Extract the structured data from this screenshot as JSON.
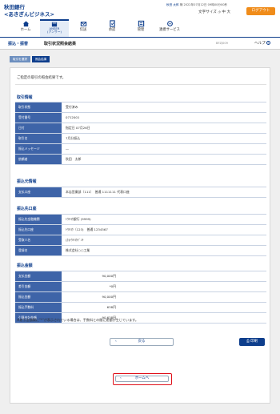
{
  "header": {
    "logo_line1": "秋田銀行",
    "logo_line2": "<あきぎんビジネス>",
    "user_name": "秋田 太郎",
    "user_suffix": "様",
    "last_login": "2022年07月12日 09時00分00秒",
    "font_size_label": "文字サイズ",
    "font_small": "小",
    "font_medium": "中",
    "font_large": "大",
    "logout_label": "ログアウト"
  },
  "nav": {
    "items": [
      {
        "label": "ホーム",
        "icon": "home-icon"
      },
      {
        "label": "ANSER\n(アンサー)",
        "icon": "anser-icon"
      },
      {
        "label": "伝送",
        "icon": "transmission-icon"
      },
      {
        "label": "承認",
        "icon": "approval-icon"
      },
      {
        "label": "管理",
        "icon": "management-icon"
      },
      {
        "label": "連携サービス",
        "icon": "linked-services-icon"
      }
    ]
  },
  "title_bar": {
    "breadcrumb": "振込・振替",
    "page_title": "取引状況照会結果",
    "screen_id": "BFZJ009",
    "help_label": "ヘルプ"
  },
  "steps": [
    "取引を選択",
    "照会結果"
  ],
  "intro_text": "ご指定の取引の照会結果です。",
  "sections": {
    "transaction_info": {
      "heading": "取引情報",
      "rows": [
        {
          "label": "取引状態",
          "value": "受付済み"
        },
        {
          "label": "受付番号",
          "value": "0712001"
        },
        {
          "label": "日付",
          "value": "指定日 07月26日"
        },
        {
          "label": "取引名",
          "value": "7月分振込"
        },
        {
          "label": "振込メッセージ",
          "value": "―"
        },
        {
          "label": "依頼者",
          "value": "秋田　太郎"
        }
      ]
    },
    "source_info": {
      "heading": "振込元情報",
      "rows": [
        {
          "label": "支払口座",
          "value": "本店営業部（111）　普通 1111111 代表口座"
        }
      ]
    },
    "destination_info": {
      "heading": "振込先口座",
      "rows": [
        {
          "label": "振込先金融機関",
          "value": "ﾄｳｷﾖｳ銀行 (9999)"
        },
        {
          "label": "振込先口座",
          "value": "ﾄｳｷﾖｳ（123)　普通 1234567"
        },
        {
          "label": "受取人名",
          "value": "(ｶ)ﾄｳｷﾖｳﾃﾞﾝｷ"
        },
        {
          "label": "登録名",
          "value": "株式会社○○工業"
        }
      ]
    },
    "amount_info": {
      "heading": "振込金額",
      "rows": [
        {
          "label": "支払金額",
          "value": "90,000円"
        },
        {
          "label": "差引金額",
          "value": "*0円"
        },
        {
          "label": "振込金額",
          "value": "90,000円"
        },
        {
          "label": "振込手数料",
          "value": "638円"
        },
        {
          "label": "引落合計金額",
          "value": "90,638円"
        }
      ]
    }
  },
  "note": "※差引金額欄に\"*\"が表示されている場合は、手数料との間に差額が生じています。",
  "buttons": {
    "back_label": "戻る",
    "print_label": "印刷",
    "home_label": "ホームへ"
  }
}
